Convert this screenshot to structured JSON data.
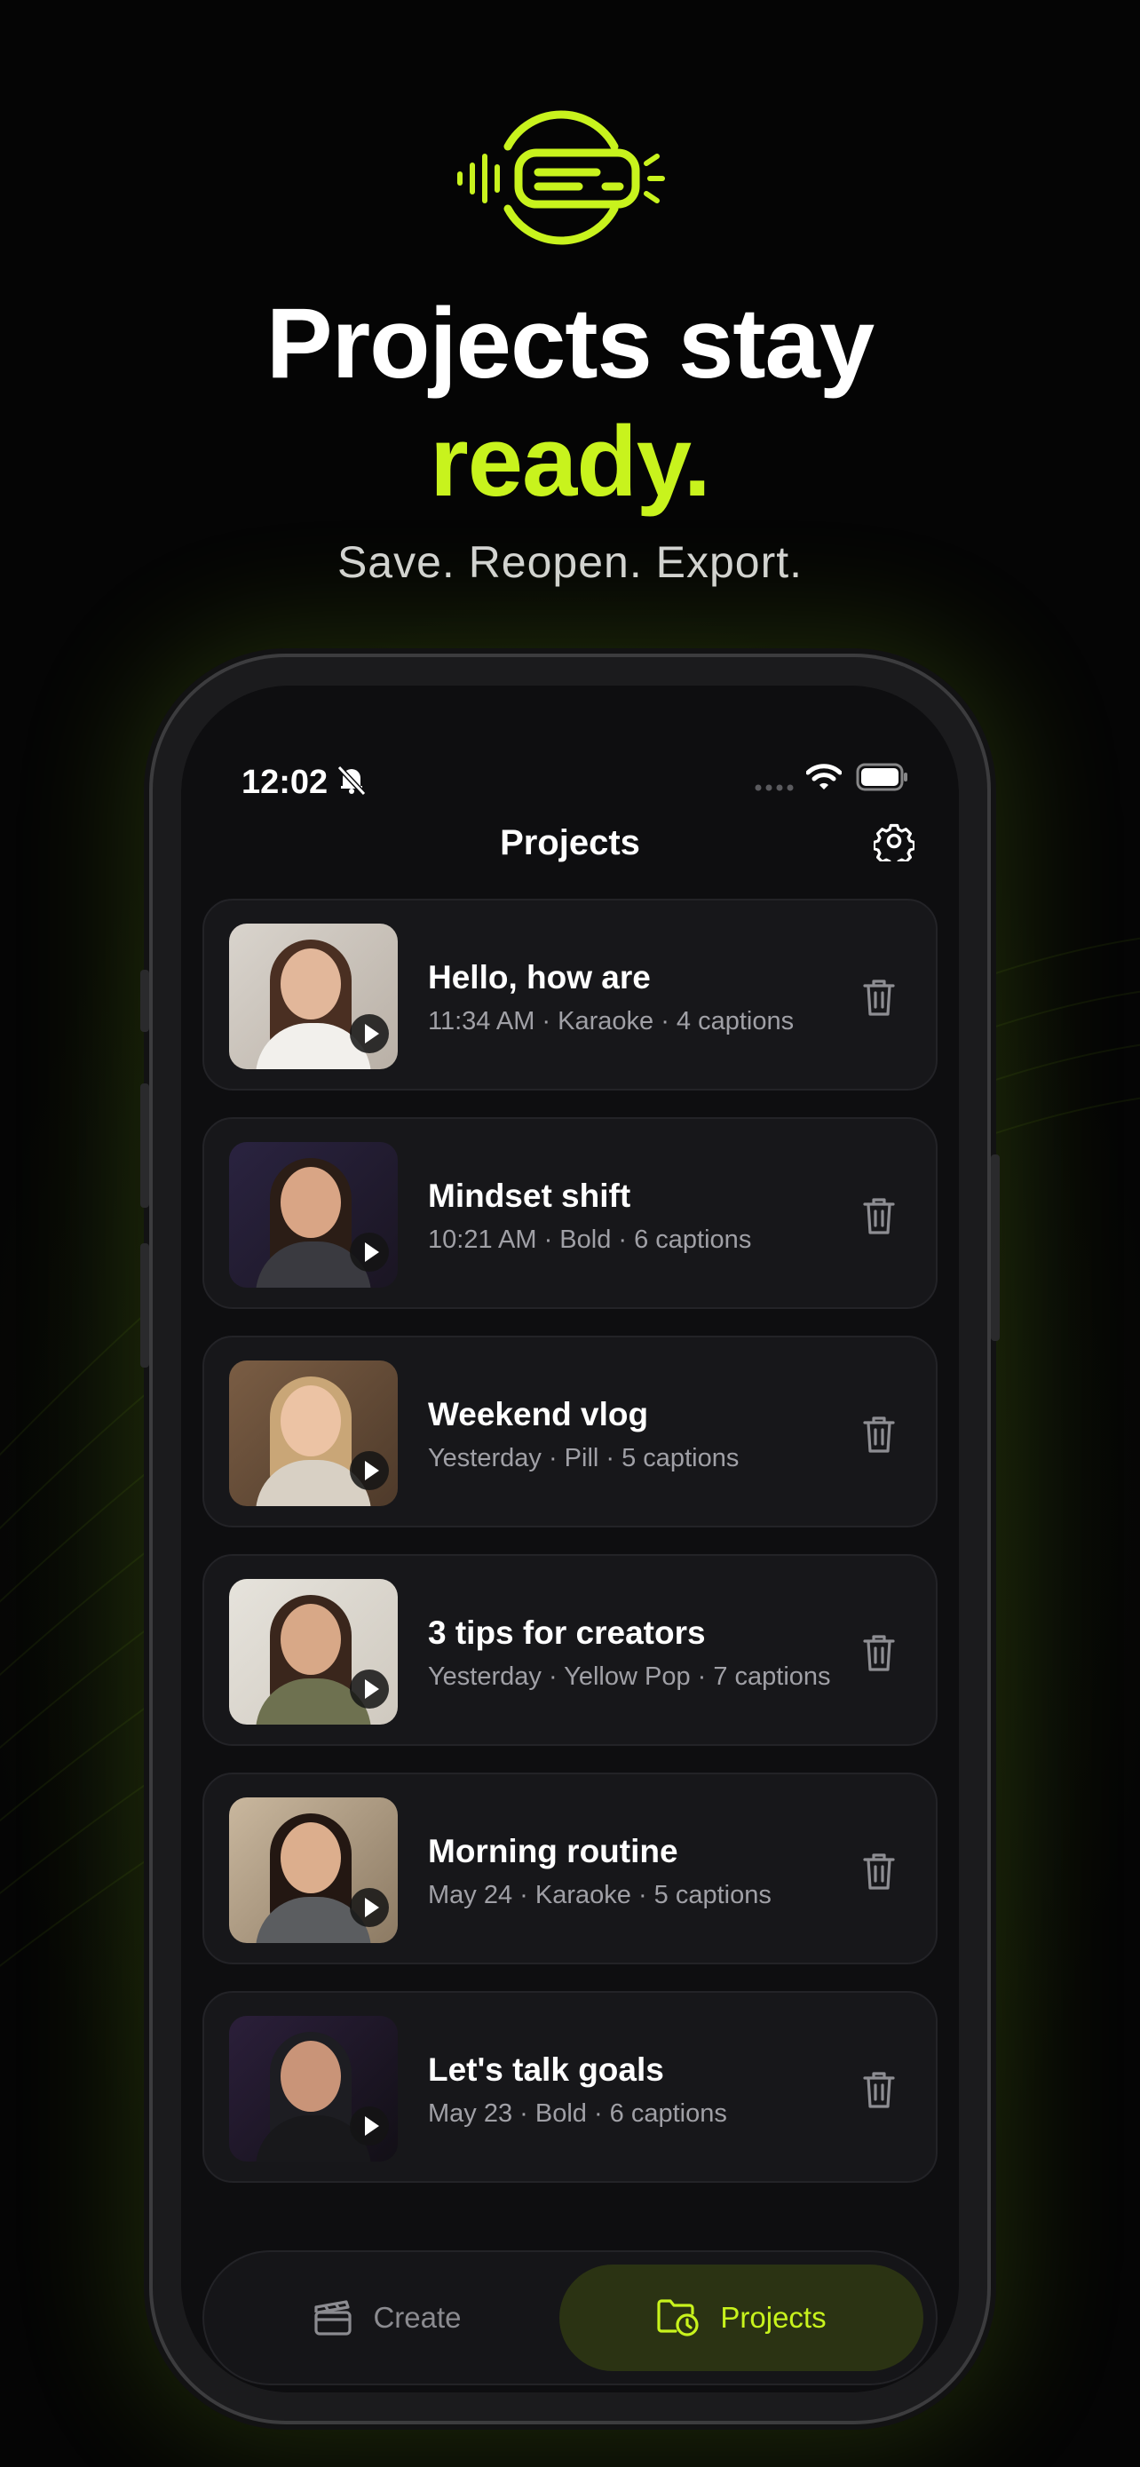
{
  "hero": {
    "headline_line1": "Projects stay",
    "headline_line2": "ready.",
    "subtitle": "Save. Reopen. Export.",
    "logo_icon": "caption-waveform-logo-icon",
    "accent_color": "#c8f31d"
  },
  "status_bar": {
    "time": "12:02",
    "silent_icon": "bell-slash-icon",
    "wifi_icon": "wifi-icon",
    "battery_icon": "battery-icon"
  },
  "header": {
    "title": "Projects",
    "settings_icon": "gear-icon"
  },
  "projects": [
    {
      "title": "Hello, how are",
      "meta": "11:34 AM · Karaoke · 4 captions"
    },
    {
      "title": "Mindset shift",
      "meta": "10:21 AM · Bold · 6 captions"
    },
    {
      "title": "Weekend vlog",
      "meta": "Yesterday · Pill · 5 captions"
    },
    {
      "title": "3 tips for creators",
      "meta": "Yesterday · Yellow Pop · 7 captions"
    },
    {
      "title": "Morning routine",
      "meta": "May 24 · Karaoke · 5 captions"
    },
    {
      "title": "Let's talk goals",
      "meta": "May 23 · Bold · 6 captions"
    }
  ],
  "tab_bar": {
    "create_label": "Create",
    "create_icon": "clapperboard-icon",
    "projects_label": "Projects",
    "projects_icon": "folder-clock-icon",
    "active_tab": "Projects"
  }
}
